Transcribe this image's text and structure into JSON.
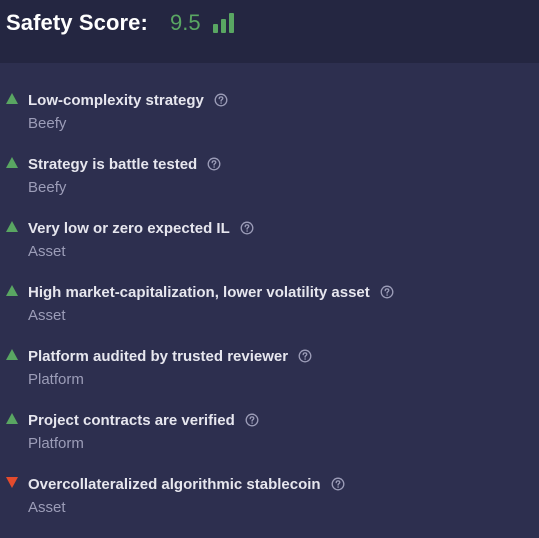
{
  "header": {
    "title": "Safety Score:",
    "score": "9.5",
    "score_color": "#59a662",
    "icon": "signal-bars-icon"
  },
  "colors": {
    "positive": "#59a662",
    "negative": "#e44b2d",
    "background": "#2d2f4f",
    "header_background": "#242641"
  },
  "factors": [
    {
      "label": "Low-complexity strategy",
      "source": "Beefy",
      "direction": "up",
      "icon": "help-circle-icon"
    },
    {
      "label": "Strategy is battle tested",
      "source": "Beefy",
      "direction": "up",
      "icon": "help-circle-icon"
    },
    {
      "label": "Very low or zero expected IL",
      "source": "Asset",
      "direction": "up",
      "icon": "help-circle-icon"
    },
    {
      "label": "High market-capitalization, lower volatility asset",
      "source": "Asset",
      "direction": "up",
      "icon": "help-circle-icon"
    },
    {
      "label": "Platform audited by trusted reviewer",
      "source": "Platform",
      "direction": "up",
      "icon": "help-circle-icon"
    },
    {
      "label": "Project contracts are verified",
      "source": "Platform",
      "direction": "up",
      "icon": "help-circle-icon"
    },
    {
      "label": "Overcollateralized algorithmic stablecoin",
      "source": "Asset",
      "direction": "down",
      "icon": "help-circle-icon"
    }
  ]
}
